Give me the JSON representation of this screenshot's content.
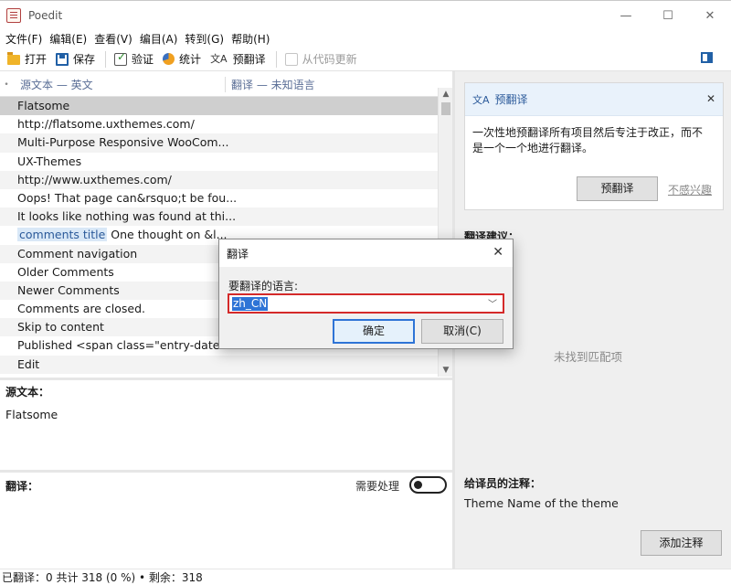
{
  "window": {
    "title": "Poedit",
    "minimize": "—",
    "maximize": "☐",
    "close": "✕"
  },
  "menu": [
    "文件(F)",
    "编辑(E)",
    "查看(V)",
    "编目(A)",
    "转到(G)",
    "帮助(H)"
  ],
  "toolbar": {
    "open": "打开",
    "save": "保存",
    "validate": "验证",
    "stats": "统计",
    "pretranslate": "预翻译",
    "update_from_code": "从代码更新"
  },
  "list": {
    "header_source": "源文本 — 英文",
    "header_translation": "翻译 — 未知语言",
    "rows": [
      "Flatsome",
      "http://flatsome.uxthemes.com/",
      "Multi-Purpose Responsive WooCom...",
      "UX-Themes",
      "http://www.uxthemes.com/",
      "Oops! That page can&rsquo;t be fou...",
      "It looks like nothing was found at thi...",
      "One thought on &l...",
      "Comment navigation",
      "Older Comments",
      "Newer Comments",
      "Comments are closed.",
      "Skip to content",
      "Published <span class=\"entry-date\"...",
      "Edit"
    ],
    "context_tag": "comments title"
  },
  "editor": {
    "source_label": "源文本：",
    "source_text": "Flatsome",
    "translation_label": "翻译：",
    "fuzzy_label": "需要处理"
  },
  "sidebar": {
    "pretranslate_title": "预翻译",
    "pretranslate_desc_1": "一次性地预翻译所有项目然后专注于改正，而不",
    "pretranslate_desc_2": "是一个一个地进行翻译。",
    "pretranslate_button": "预翻译",
    "not_interested": "不感兴趣",
    "suggestions_label": "翻译建议：",
    "no_match": "未找到匹配项",
    "notes_label": "给译员的注释：",
    "notes_text": "Theme Name of the theme",
    "add_comment": "添加注释"
  },
  "status": "已翻译：0 共计 318 (0 %) • 剩余：318",
  "dialog": {
    "title": "翻译",
    "label": "要翻译的语言:",
    "value": "zh_CN",
    "ok": "确定",
    "cancel": "取消(C)",
    "close": "✕"
  }
}
